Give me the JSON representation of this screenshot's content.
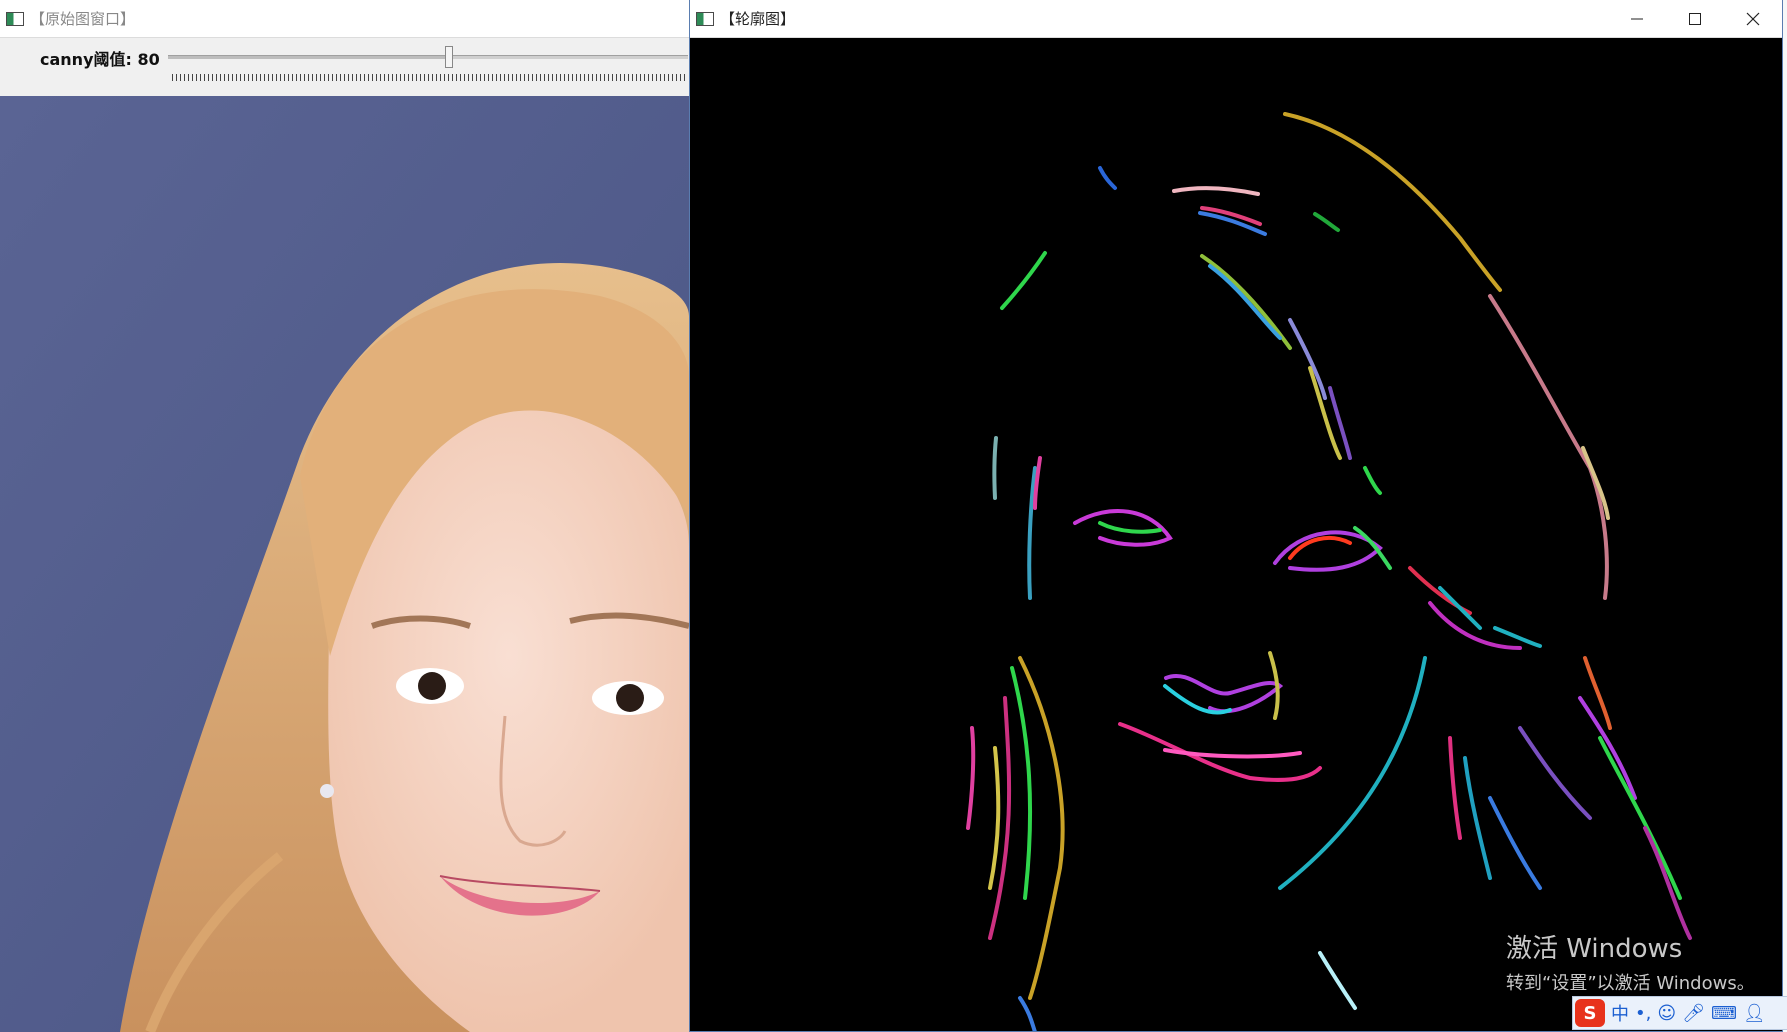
{
  "left_window": {
    "title": "【原始图窗口】",
    "trackbar": {
      "label": "canny阈值: 80",
      "value": 80,
      "max": 148
    },
    "image_alt": "portrait photo"
  },
  "right_window": {
    "title": "【轮廓图】",
    "controls": {
      "minimize": "—",
      "maximize": "☐",
      "close": "✕"
    },
    "canvas_background": "#000000"
  },
  "watermark": {
    "line1": "激活 Windows",
    "line2": "转到“设置”以激活 Windows。"
  },
  "ime_bar": {
    "logo": "S",
    "mode": "中",
    "punct": "•,",
    "icons": [
      "emoji-icon",
      "microphone-icon",
      "keyboard-icon",
      "user-icon"
    ]
  },
  "colors": {
    "accent_border": "#5a7db0",
    "background": "#f0f0f0"
  }
}
